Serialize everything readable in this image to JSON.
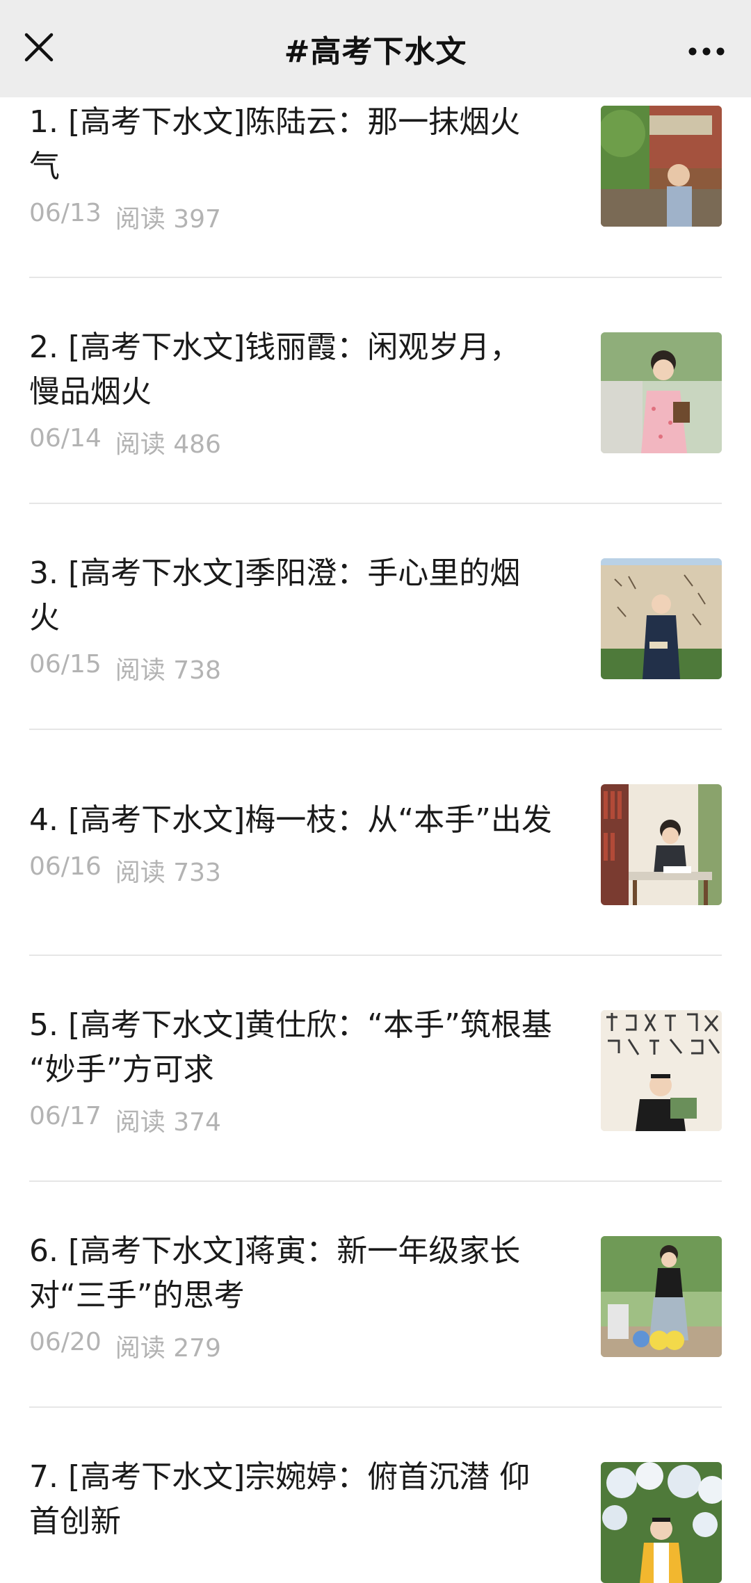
{
  "header": {
    "title": "#高考下水文",
    "close_icon": "close-icon",
    "more_icon": "more-dots-icon"
  },
  "articles": [
    {
      "title": "1. [高考下水文]陈陆云：那一抹烟火\n气",
      "date": "06/13",
      "reads": "阅读 397",
      "thumb": "thumb-teacher-outdoor"
    },
    {
      "title": "2. [高考下水文]钱丽霞：闲观岁月，\n慢品烟火",
      "date": "06/14",
      "reads": "阅读 486",
      "thumb": "thumb-teacher-floral-dress"
    },
    {
      "title": "3. [高考下水文]季阳澄：手心里的烟\n火",
      "date": "06/15",
      "reads": "阅读 738",
      "thumb": "thumb-teacher-calligraphy-wall"
    },
    {
      "title": "4. [高考下水文]梅一枝：从“本手”出发",
      "date": "06/16",
      "reads": "阅读 733",
      "thumb": "thumb-teacher-library"
    },
    {
      "title": "5. [高考下水文]黄仕欣：“本手”筑根基\n“妙手”方可求",
      "date": "06/17",
      "reads": "阅读 374",
      "thumb": "thumb-teacher-reading"
    },
    {
      "title": "6. [高考下水文]蒋寅：新一年级家长\n对“三手”的思考",
      "date": "06/20",
      "reads": "阅读 279",
      "thumb": "thumb-park-balloons"
    },
    {
      "title": "7. [高考下水文]宗婉婷：俯首沉潜 仰\n首创新",
      "date": "",
      "reads": "",
      "thumb": "thumb-hydrangea"
    }
  ]
}
